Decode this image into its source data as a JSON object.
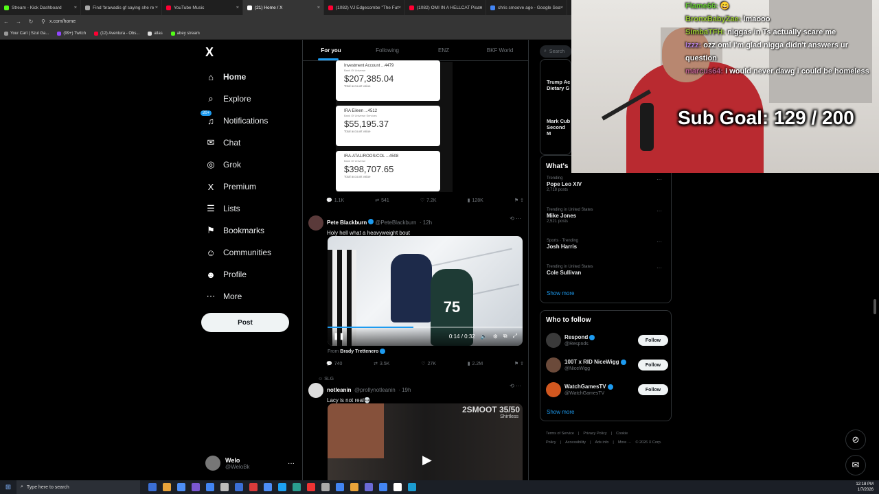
{
  "browser": {
    "tabs": [
      {
        "title": "Stream - Kick Dashboard",
        "color": "#53fc18"
      },
      {
        "title": "Find 'brawadis gf saying she re",
        "color": "#aaaaaa"
      },
      {
        "title": "YouTube Music",
        "color": "#ff0033"
      },
      {
        "title": "(21) Home / X",
        "color": "#ffffff",
        "active": true
      },
      {
        "title": "(1082) VJ Edgecombe \"The Fut",
        "color": "#ff0033"
      },
      {
        "title": "(1082) OMI IN A HELLCAT Pisan",
        "color": "#ff0033"
      },
      {
        "title": "chris smoove age - Google Sea",
        "color": "#4285f4"
      }
    ],
    "url": "x.com/home",
    "bookmarks": [
      "Your Cart | Szul Ga...",
      "(99+) Twitch",
      "(12) Aventura - Obs...",
      "allas",
      "abey stream"
    ]
  },
  "sidebar": {
    "logo": "X",
    "items": [
      {
        "label": "Home",
        "icon": "home-icon",
        "glyph": "⌂"
      },
      {
        "label": "Explore",
        "icon": "search-icon",
        "glyph": "⌕"
      },
      {
        "label": "Notifications",
        "icon": "bell-icon",
        "glyph": "♫",
        "badge": "20+"
      },
      {
        "label": "Chat",
        "icon": "mail-icon",
        "glyph": "✉"
      },
      {
        "label": "Grok",
        "icon": "grok-icon",
        "glyph": "◎"
      },
      {
        "label": "Premium",
        "icon": "x-icon",
        "glyph": "X"
      },
      {
        "label": "Lists",
        "icon": "list-icon",
        "glyph": "☰"
      },
      {
        "label": "Bookmarks",
        "icon": "bookmark-icon",
        "glyph": "⚑"
      },
      {
        "label": "Communities",
        "icon": "people-icon",
        "glyph": "☺"
      },
      {
        "label": "Profile",
        "icon": "user-icon",
        "glyph": "☻"
      },
      {
        "label": "More",
        "icon": "more-icon",
        "glyph": "⋯"
      }
    ],
    "post_label": "Post",
    "account": {
      "name": "Welo",
      "handle": "@WeloBk"
    }
  },
  "timeline": {
    "tabs": [
      "For you",
      "Following",
      "ENZ",
      "BKF World"
    ],
    "bank_cards": [
      {
        "name": "Investment Account ...4479",
        "bank": "Bank Of Universe",
        "amount": "$207,385.04",
        "caption": "Total account value"
      },
      {
        "name": "IRA Eileen ...4512",
        "bank": "Bank Of Universe Services",
        "amount": "$55,195.37",
        "caption": "Total account value"
      },
      {
        "name": "IRA-ATAL/ROOS/COL ...4508",
        "bank": "Bank Of Universe",
        "amount": "$398,707.65",
        "caption": "Total account value"
      }
    ],
    "tweet1_actions": {
      "replies": "1.1K",
      "reposts": "541",
      "likes": "7.2K",
      "views": "128K"
    },
    "tweet2": {
      "name": "Pete Blackburn",
      "handle": "@PeteBlackburn",
      "time": "· 12h",
      "text": "Holy hell what a heavyweight bout",
      "video_time": "0:14 / 0:32",
      "video_progress": 0.44,
      "jersey": "75",
      "from_label": "From",
      "from_name": "Brady Trettenero",
      "actions": {
        "replies": "740",
        "reposts": "3.5K",
        "likes": "27K",
        "views": "2.2M"
      }
    },
    "tweet3": {
      "social": "SLG",
      "name": "notleanin",
      "handle": "@prollynotleanin",
      "time": "· 19h",
      "text": "Lacy is not real💀",
      "thumb_goal": "2SMOOT 35/50",
      "thumb_sub": "Shirtless"
    }
  },
  "right": {
    "search_placeholder": "Search",
    "news": [
      "Trump Ac",
      "Dietary G",
      "Mark Cub",
      "Second M"
    ],
    "trends_title": "What's",
    "trends": [
      {
        "category": "Trending",
        "name": "Pope Leo XIV",
        "count": "2,718 posts"
      },
      {
        "category": "Trending in United States",
        "name": "Mike Jones",
        "count": "2,521 posts"
      },
      {
        "category": "Sports · Trending",
        "name": "Josh Harris",
        "count": ""
      },
      {
        "category": "Trending in United States",
        "name": "Cole Sullivan",
        "count": ""
      }
    ],
    "show_more": "Show more",
    "who_to_follow_title": "Who to follow",
    "follow": [
      {
        "name": "Respond",
        "handle": "@Respnds",
        "color": "#3a3a3a"
      },
      {
        "name": "100T x RID NiceWigg",
        "handle": "@NiceWigg",
        "color": "#6b4a3a"
      },
      {
        "name": "WatchGamesTV",
        "handle": "@WatchGamesTV",
        "color": "#d1571f"
      }
    ],
    "follow_label": "Follow",
    "footer": [
      "Terms of Service",
      "|",
      "Privacy Policy",
      "|",
      "Cookie Policy",
      "|",
      "Accessibility",
      "|",
      "Ads info",
      "|",
      "More ···",
      "© 2026 X Corp."
    ]
  },
  "stream": {
    "chat": [
      {
        "user": "Flame66:",
        "msg": "😄",
        "cls": "u1"
      },
      {
        "user": "BronxBabyZae:",
        "msg": "lmaooo",
        "cls": "u2"
      },
      {
        "user": "SimbaTFH:",
        "msg": "niggas in Ts actually scare me",
        "cls": "u2"
      },
      {
        "user": "Izzz:",
        "msg": "ozz oml I'm glad nigga didn't answers ur question",
        "cls": "u3"
      },
      {
        "user": "marcus64:",
        "msg": "i would never dawg i could be homeless",
        "cls": "u4"
      }
    ],
    "sub_goal": "Sub Goal:  129 / 200"
  },
  "taskbar": {
    "search_placeholder": "Type here to search",
    "time": "12:18 PM",
    "date": "1/7/2026"
  }
}
